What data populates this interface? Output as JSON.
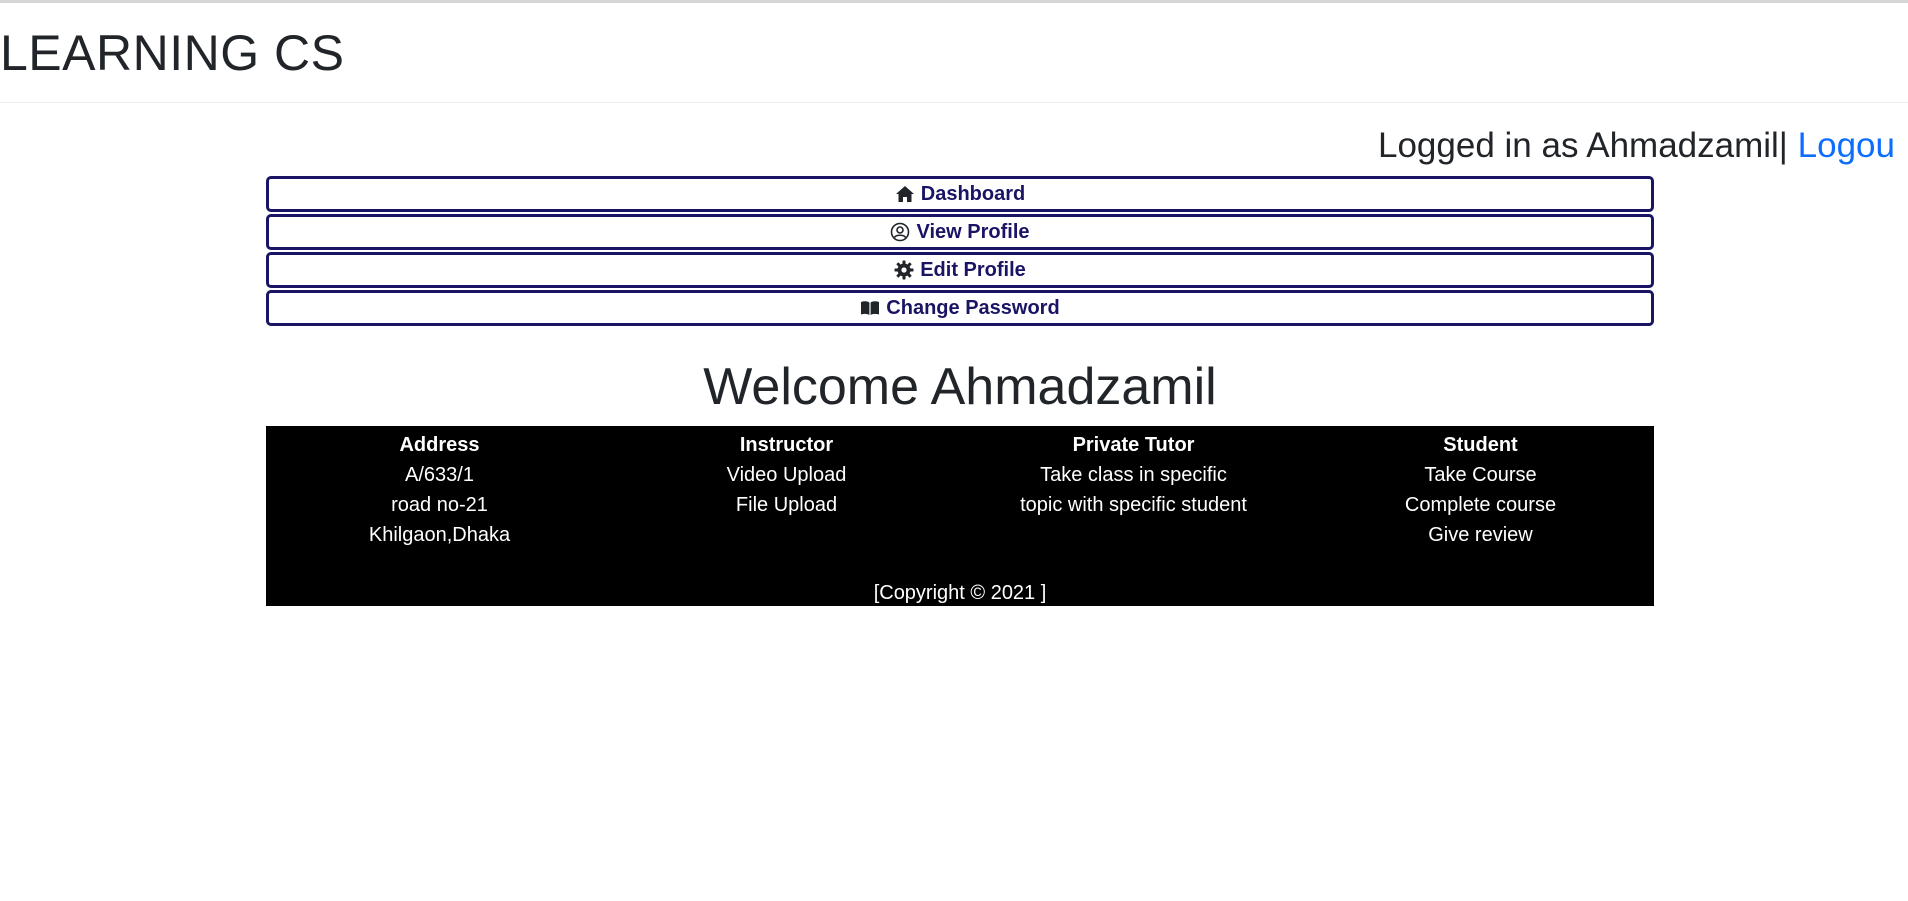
{
  "header": {
    "title": "LEARNING CS"
  },
  "session": {
    "logged_in_text": "Logged in as Ahmadzamil|",
    "logout_label": "Logou"
  },
  "nav": {
    "items": [
      {
        "label": "Dashboard",
        "icon": "house-icon"
      },
      {
        "label": "View Profile",
        "icon": "user-circle-icon"
      },
      {
        "label": "Edit Profile",
        "icon": "gear-icon"
      },
      {
        "label": "Change Password",
        "icon": "book-icon"
      }
    ]
  },
  "welcome": {
    "text": "Welcome Ahmadzamil"
  },
  "footer": {
    "columns": [
      {
        "heading": "Address",
        "lines": [
          "A/633/1",
          "road no-21",
          "Khilgaon,Dhaka"
        ]
      },
      {
        "heading": "Instructor",
        "lines": [
          "Video Upload",
          "File Upload"
        ]
      },
      {
        "heading": "Private Tutor",
        "lines": [
          "Take class in specific",
          "topic with specific student"
        ]
      },
      {
        "heading": "Student",
        "lines": [
          "Take Course",
          "Complete course",
          "Give review"
        ]
      }
    ],
    "copyright": "[Copyright © 2021 ]"
  },
  "colors": {
    "nav_border": "#1a1464",
    "link": "#0d6efd",
    "footer_bg": "#000000"
  }
}
